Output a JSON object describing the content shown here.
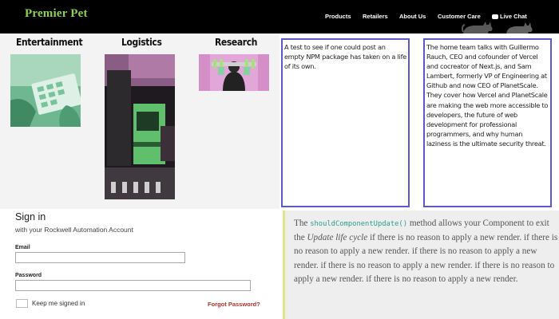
{
  "header": {
    "logo": "Premier Pet",
    "nav": [
      "Products",
      "Retailers",
      "About Us",
      "Customer Care",
      "Live Chat"
    ]
  },
  "categories": [
    "Entertainment",
    "Logistics",
    "Research"
  ],
  "textboxes": {
    "left": "A test to see if one could post an empty NPM package has taken on a life of its own.",
    "right": "The home team talks with Guillermo Rauch, CEO and cofounder of Vercel and cocreator of Next.js, and Sam Lambert, formerly VP of Engineering at Github and now CEO of PlanetScale. They cover how Vercel and PlanetScale are making the web more accessible to developers, the future of web development for professional programmers, and why human laziness is the ultimate security threat."
  },
  "signin": {
    "title": "Sign in",
    "subtitle": "with your Rockwell Automation Account",
    "email_label": "Email",
    "password_label": "Password",
    "keep_label": "Keep me signed in",
    "forgot_label": "Forgot Password?",
    "email_value": "",
    "password_value": ""
  },
  "react_note": {
    "pre": "The",
    "method": "shouldComponentUpdate()",
    "mid": "method allows your Component to exit the",
    "cycle": "Update life cycle",
    "rest": "if there is no reason to apply a new render. if there is no reason to apply a new render. if there is no reason to apply a new render. if there is no reason to apply a new render. if there is no reason to apply a new render. if there is no reason to apply a new render."
  },
  "colors": {
    "logo_green": "#8fd14f",
    "box_border": "#5b58c8",
    "forgot_red": "#b5302a",
    "code_teal": "#2c9d8b"
  },
  "icons": [
    "chat-bubble-icon",
    "cat-silhouette-icon"
  ]
}
